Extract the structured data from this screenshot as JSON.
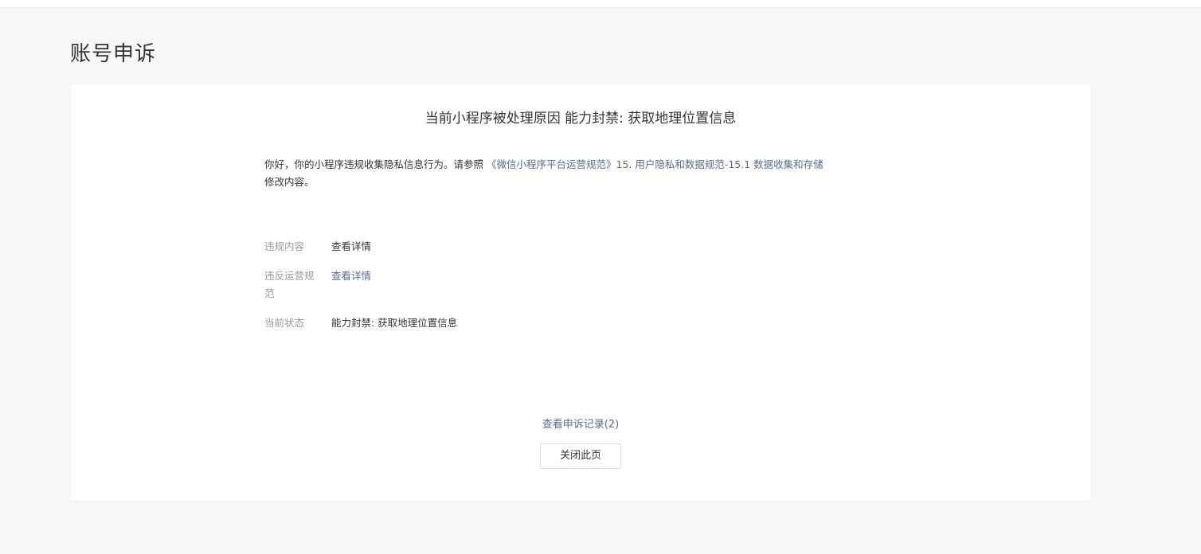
{
  "page": {
    "title": "账号申诉"
  },
  "card": {
    "reason_title": "当前小程序被处理原因 能力封禁: 获取地理位置信息",
    "notice": {
      "text_before_link": "你好，你的小程序违规收集隐私信息行为。请参照 ",
      "link_text": "《微信小程序平台运营规范》15. 用户隐私和数据规范-15.1 数据收集和存储",
      "text_after_link": "修改内容。"
    },
    "info_rows": [
      {
        "label": "违规内容",
        "value": "查看详情"
      },
      {
        "label": "违反运营规范",
        "value": "查看详情"
      },
      {
        "label": "当前状态",
        "value": "能力封禁: 获取地理位置信息"
      }
    ],
    "records_link": "查看申诉记录(2)",
    "close_button": "关闭此页"
  },
  "colors": {
    "background": "#f6f7f9",
    "card": "#ffffff",
    "link": "#576b95",
    "label": "#9a9a9a",
    "text": "#353535"
  }
}
